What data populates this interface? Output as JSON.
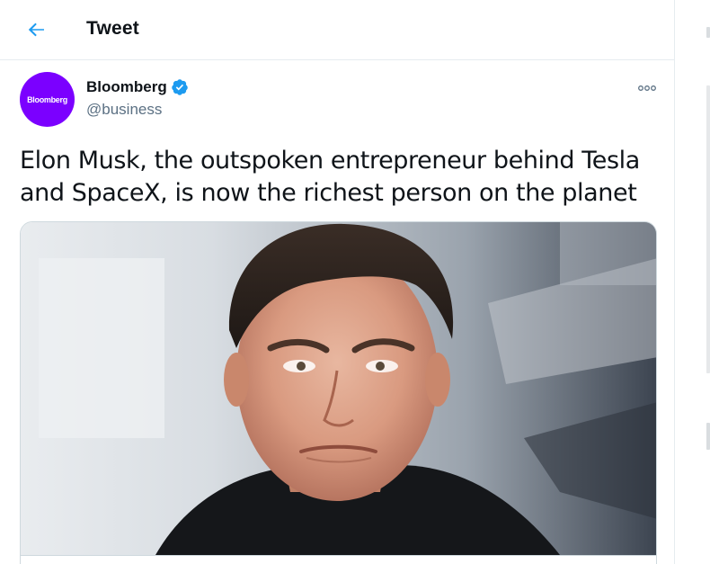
{
  "header": {
    "title": "Tweet",
    "back_icon": "arrow-left-icon",
    "accent_color": "#1d9bf0"
  },
  "author": {
    "display_name": "Bloomberg",
    "handle": "@business",
    "avatar_text": "Bloomberg",
    "avatar_color": "#7b00ff",
    "verified": true,
    "verified_icon": "verified-badge-icon",
    "verified_color": "#1d9bf0"
  },
  "more_icon": "more-options-icon",
  "tweet": {
    "text": "Elon Musk, the outspoken entrepreneur behind Tesla and SpaceX, is now the richest person on the planet"
  },
  "media": {
    "type": "photo",
    "icon": "photo-icon"
  }
}
